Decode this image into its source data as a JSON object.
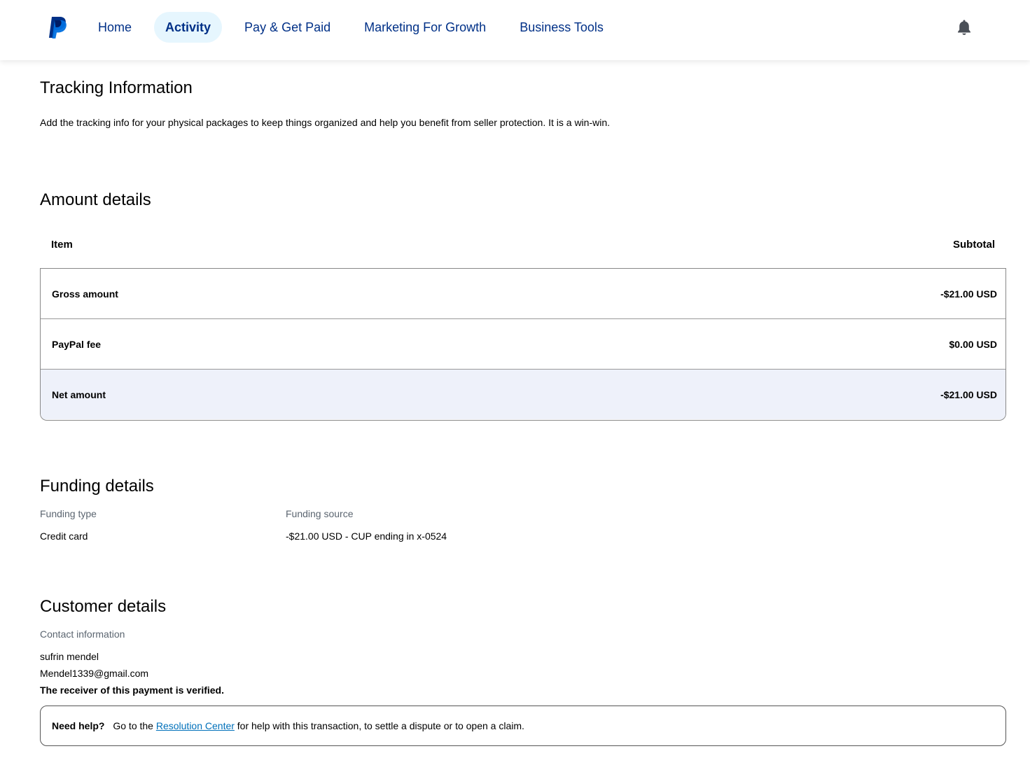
{
  "header": {
    "nav": [
      {
        "label": "Home"
      },
      {
        "label": "Activity"
      },
      {
        "label": "Pay & Get Paid"
      },
      {
        "label": "Marketing For Growth"
      },
      {
        "label": "Business Tools"
      }
    ],
    "active_tab": "Activity",
    "logo_icon": "paypal-logo",
    "notification_icon": "bell-icon"
  },
  "tracking": {
    "title": "Tracking Information",
    "description": "Add the tracking info for your physical packages to keep things organized and help you benefit from seller protection. It is a win-win."
  },
  "amount": {
    "title": "Amount details",
    "col_item": "Item",
    "col_subtotal": "Subtotal",
    "rows": [
      {
        "label": "Gross amount",
        "value": "-$21.00 USD"
      },
      {
        "label": "PayPal fee",
        "value": "$0.00 USD"
      },
      {
        "label": "Net amount",
        "value": "-$21.00 USD"
      }
    ]
  },
  "funding": {
    "title": "Funding details",
    "type_label": "Funding type",
    "type_value": "Credit card",
    "source_label": "Funding source",
    "source_value": "-$21.00 USD - CUP ending in x-0524"
  },
  "customer": {
    "title": "Customer details",
    "contact_label": "Contact information",
    "name": "sufrin mendel",
    "email": "Mendel1339@gmail.com",
    "verified_text": "The receiver of this payment is verified."
  },
  "help": {
    "need_help": "Need help?",
    "prefix": "Go to the ",
    "link": "Resolution Center",
    "suffix": " for help with this transaction, to settle a dispute or to open a claim."
  },
  "colors": {
    "brand_navy": "#003087",
    "brand_blue": "#0070ba",
    "active_tab_bg": "#e6f6fe",
    "net_row_bg": "#eef1fa"
  }
}
